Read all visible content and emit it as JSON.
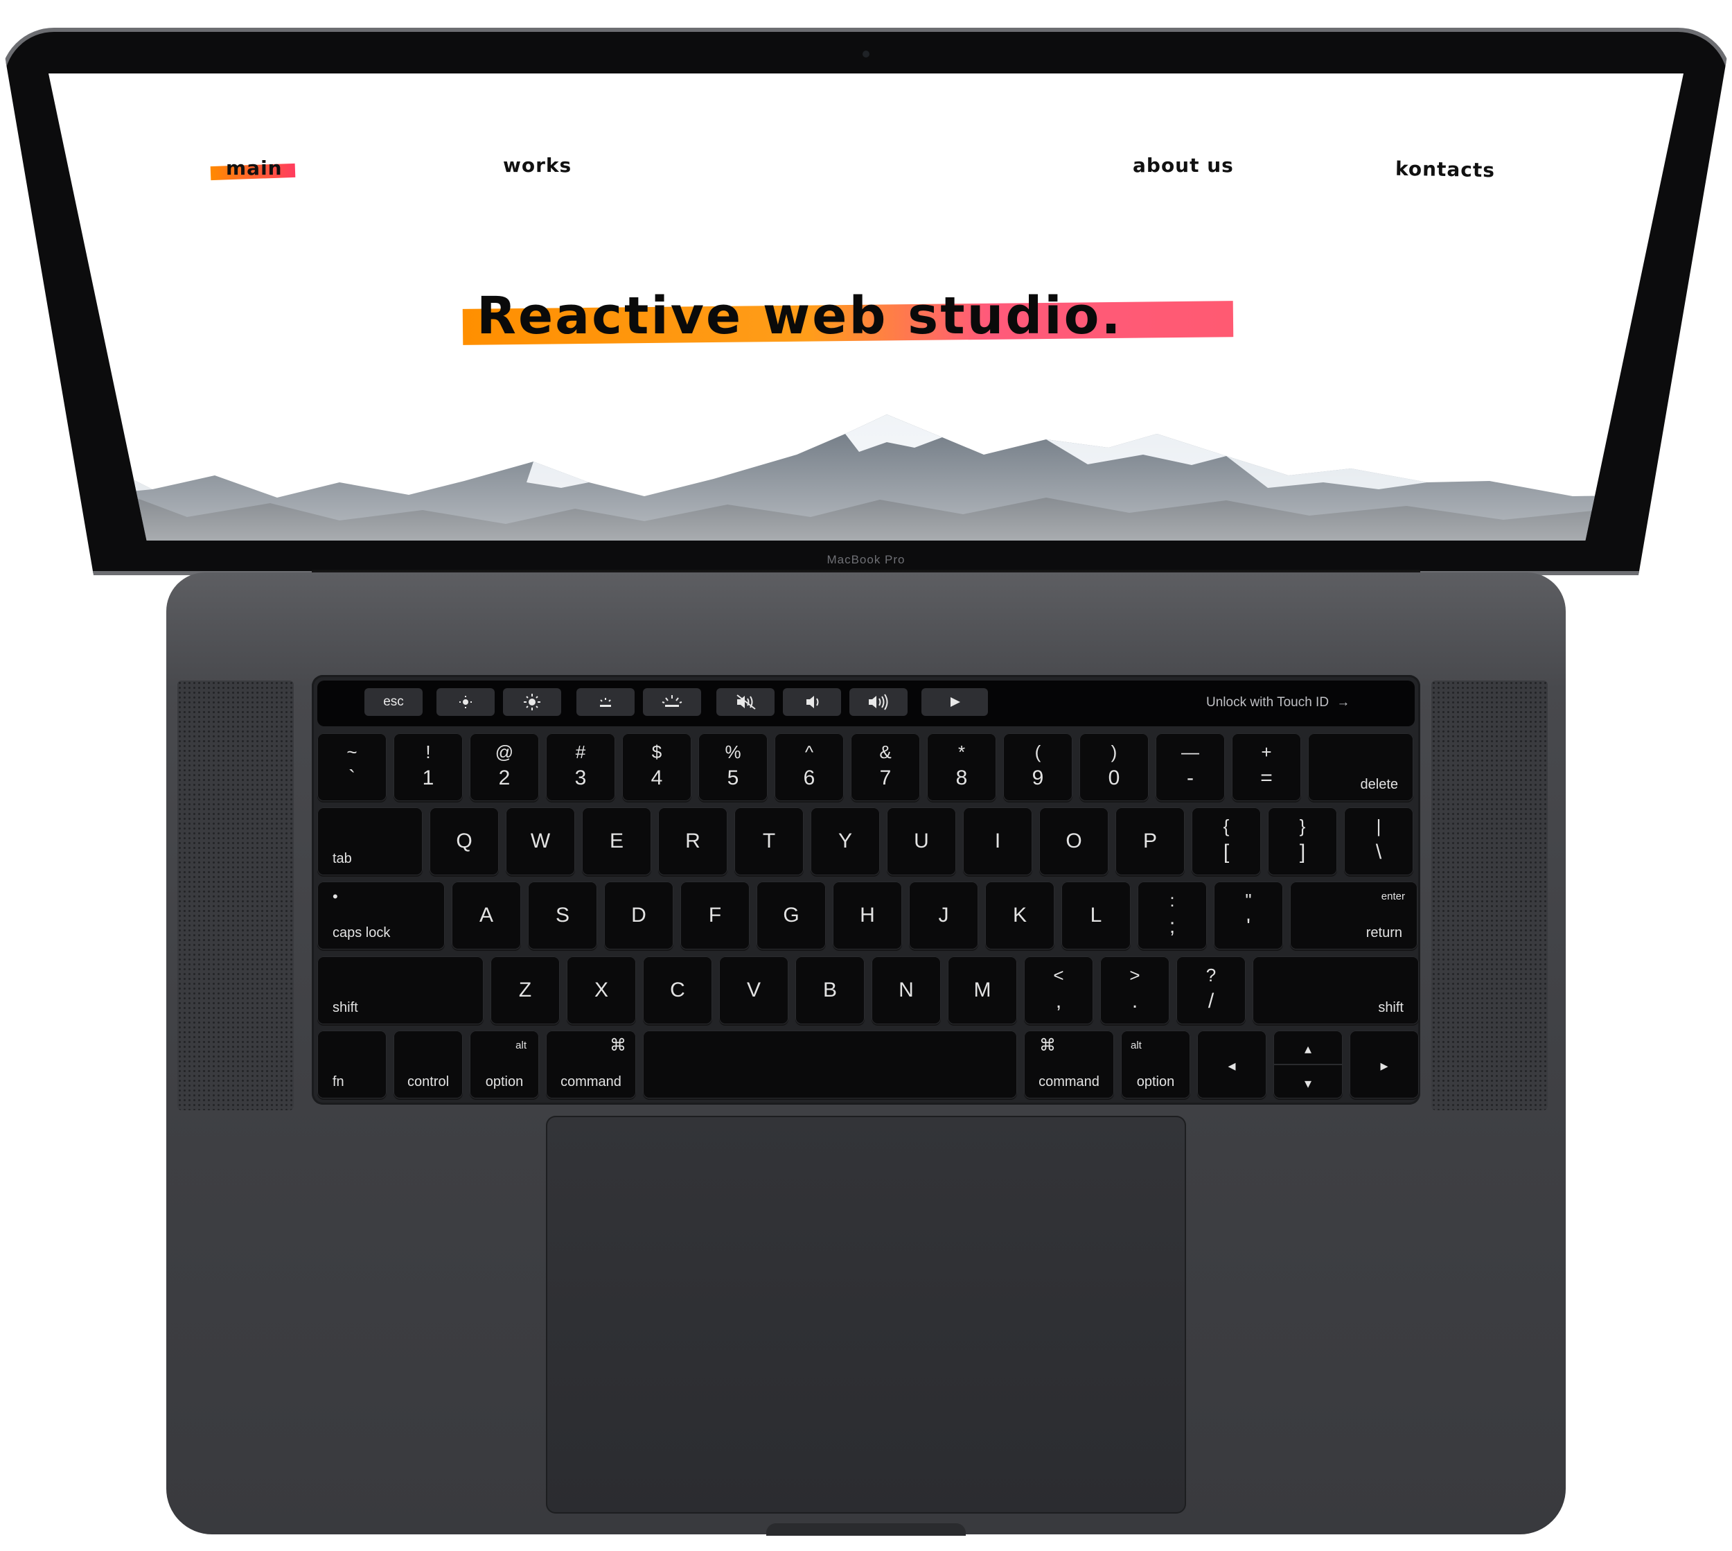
{
  "device": {
    "model_label": "MacBook Pro"
  },
  "site": {
    "nav": {
      "main": "main",
      "works": "works",
      "about": "about us",
      "kontacts": "kontacts"
    },
    "hero_title": "Reactive web studio.",
    "accent_colors": [
      "#ff8a00",
      "#ff3c5e"
    ]
  },
  "touchbar": {
    "esc": "esc",
    "icons": [
      "brightness-down-icon",
      "brightness-up-icon",
      "keyboard-light-down-icon",
      "keyboard-light-up-icon",
      "mute-icon",
      "volume-down-icon",
      "volume-up-icon",
      "play-icon"
    ],
    "unlock": "Unlock with Touch ID",
    "unlock_arrow": "→"
  },
  "keyboard": {
    "row1": [
      {
        "top": "~",
        "bottom": "`"
      },
      {
        "top": "!",
        "bottom": "1"
      },
      {
        "top": "@",
        "bottom": "2"
      },
      {
        "top": "#",
        "bottom": "3"
      },
      {
        "top": "$",
        "bottom": "4"
      },
      {
        "top": "%",
        "bottom": "5"
      },
      {
        "top": "^",
        "bottom": "6"
      },
      {
        "top": "&",
        "bottom": "7"
      },
      {
        "top": "*",
        "bottom": "8"
      },
      {
        "top": "(",
        "bottom": "9"
      },
      {
        "top": ")",
        "bottom": "0"
      },
      {
        "top": "—",
        "bottom": "-"
      },
      {
        "top": "+",
        "bottom": "="
      },
      {
        "label": "delete"
      }
    ],
    "row2": [
      {
        "label": "tab"
      },
      {
        "char": "Q"
      },
      {
        "char": "W"
      },
      {
        "char": "E"
      },
      {
        "char": "R"
      },
      {
        "char": "T"
      },
      {
        "char": "Y"
      },
      {
        "char": "U"
      },
      {
        "char": "I"
      },
      {
        "char": "O"
      },
      {
        "char": "P"
      },
      {
        "top": "{",
        "bottom": "["
      },
      {
        "top": "}",
        "bottom": "]"
      },
      {
        "top": "|",
        "bottom": "\\"
      }
    ],
    "row3": [
      {
        "label": "caps lock",
        "dot": "•"
      },
      {
        "char": "A"
      },
      {
        "char": "S"
      },
      {
        "char": "D"
      },
      {
        "char": "F"
      },
      {
        "char": "G"
      },
      {
        "char": "H"
      },
      {
        "char": "J"
      },
      {
        "char": "K"
      },
      {
        "char": "L"
      },
      {
        "top": ":",
        "bottom": ";"
      },
      {
        "top": "\"",
        "bottom": "'"
      },
      {
        "label": "return",
        "sup": "enter"
      }
    ],
    "row4": [
      {
        "label": "shift"
      },
      {
        "char": "Z"
      },
      {
        "char": "X"
      },
      {
        "char": "C"
      },
      {
        "char": "V"
      },
      {
        "char": "B"
      },
      {
        "char": "N"
      },
      {
        "char": "M"
      },
      {
        "top": "<",
        "bottom": ","
      },
      {
        "top": ">",
        "bottom": "."
      },
      {
        "top": "?",
        "bottom": "/"
      },
      {
        "label": "shift"
      }
    ],
    "row5": [
      {
        "label": "fn"
      },
      {
        "label": "control"
      },
      {
        "label": "option",
        "sup": "alt"
      },
      {
        "label": "command",
        "sup": "⌘"
      },
      {
        "label": ""
      },
      {
        "label": "command",
        "sup": "⌘"
      },
      {
        "label": "option",
        "sup": "alt"
      },
      {
        "arrow": "◂"
      },
      {
        "arrow_up": "▴",
        "arrow_down": "▾"
      },
      {
        "arrow": "▸"
      }
    ]
  }
}
